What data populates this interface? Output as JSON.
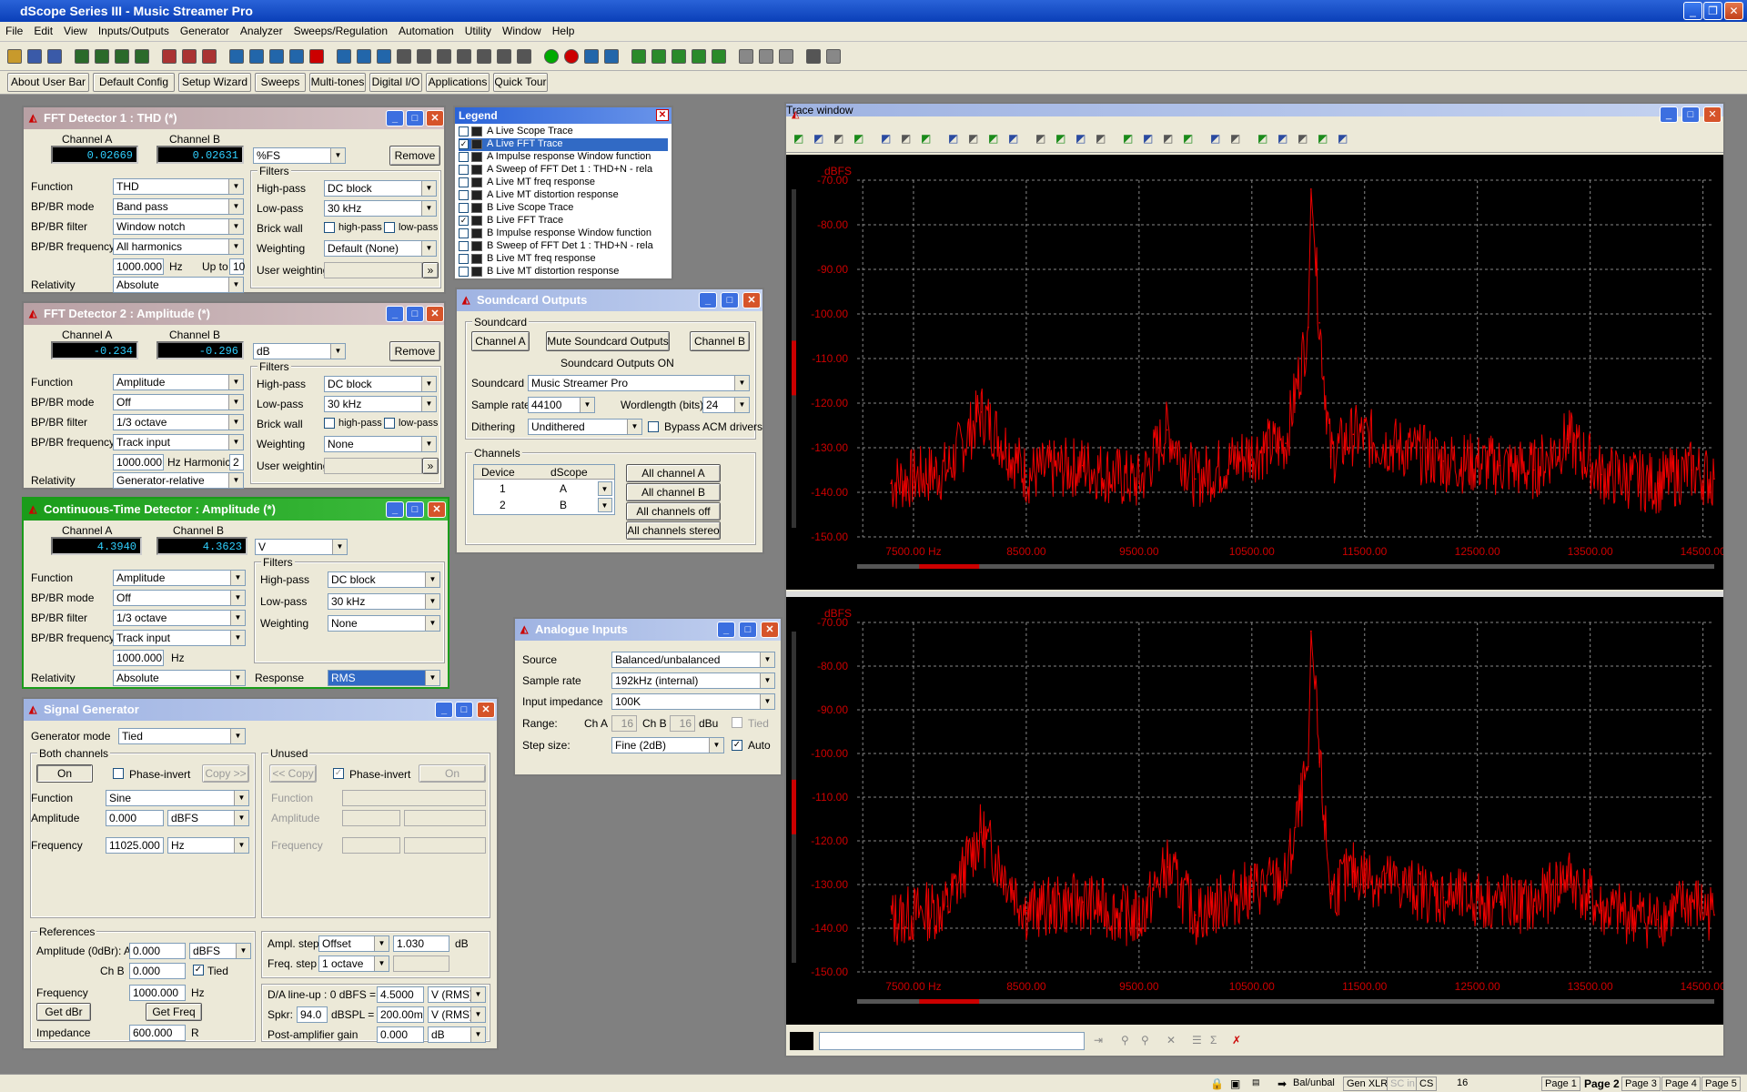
{
  "app": {
    "title": "dScope Series III - Music Streamer Pro"
  },
  "menu": [
    "File",
    "Edit",
    "View",
    "Inputs/Outputs",
    "Generator",
    "Analyzer",
    "Sweeps/Regulation",
    "Automation",
    "Utility",
    "Window",
    "Help"
  ],
  "userbar": [
    "About User Bar",
    "Default Config",
    "Setup Wizard",
    "Sweeps",
    "Multi-tones",
    "Digital I/O",
    "Applications",
    "Quick Tour"
  ],
  "fft1": {
    "title": "FFT Detector 1 : THD (*)",
    "cha_label": "Channel A",
    "chb_label": "Channel B",
    "cha_value": "0.02669",
    "chb_value": "0.02631",
    "unit": "%FS",
    "remove": "Remove",
    "function_label": "Function",
    "function": "THD",
    "bpbr_mode_label": "BP/BR mode",
    "bpbr_mode": "Band pass",
    "bpbr_filter_label": "BP/BR filter",
    "bpbr_filter": "Window notch",
    "bpbr_freq_label": "BP/BR frequency",
    "bpbr_freq": "All harmonics",
    "freq_value": "1000.000",
    "hz": "Hz",
    "upto_label": "Up to",
    "upto": "10",
    "relativity_label": "Relativity",
    "relativity": "Absolute",
    "filters_label": "Filters",
    "highpass_label": "High-pass",
    "highpass": "DC block",
    "lowpass_label": "Low-pass",
    "lowpass": "30 kHz",
    "brickwall_label": "Brick wall",
    "bw_hp": "high-pass",
    "bw_lp": "low-pass",
    "weighting_label": "Weighting",
    "weighting": "Default (None)",
    "userweight_label": "User weighting"
  },
  "fft2": {
    "title": "FFT Detector 2 : Amplitude (*)",
    "cha_label": "Channel A",
    "chb_label": "Channel B",
    "cha_value": "-0.234",
    "chb_value": "-0.296",
    "unit": "dB",
    "remove": "Remove",
    "function_label": "Function",
    "function": "Amplitude",
    "bpbr_mode_label": "BP/BR mode",
    "bpbr_mode": "Off",
    "bpbr_filter_label": "BP/BR filter",
    "bpbr_filter": "1/3 octave",
    "bpbr_freq_label": "BP/BR frequency",
    "bpbr_freq": "Track input",
    "freq_value": "1000.000",
    "hz": "Hz",
    "harmonic_label": "Harmonic",
    "harmonic": "2",
    "relativity_label": "Relativity",
    "relativity": "Generator-relative",
    "filters_label": "Filters",
    "highpass_label": "High-pass",
    "highpass": "DC block",
    "lowpass_label": "Low-pass",
    "lowpass": "30 kHz",
    "brickwall_label": "Brick wall",
    "bw_hp": "high-pass",
    "bw_lp": "low-pass",
    "weighting_label": "Weighting",
    "weighting": "None",
    "userweight_label": "User weighting"
  },
  "ctd": {
    "title": "Continuous-Time Detector : Amplitude (*)",
    "cha_label": "Channel A",
    "chb_label": "Channel B",
    "cha_value": "4.3940",
    "chb_value": "4.3623",
    "unit": "V",
    "function_label": "Function",
    "function": "Amplitude",
    "bpbr_mode_label": "BP/BR mode",
    "bpbr_mode": "Off",
    "bpbr_filter_label": "BP/BR filter",
    "bpbr_filter": "1/3 octave",
    "bpbr_freq_label": "BP/BR frequency",
    "bpbr_freq": "Track input",
    "freq_value": "1000.000",
    "hz": "Hz",
    "relativity_label": "Relativity",
    "relativity": "Absolute",
    "filters_label": "Filters",
    "highpass_label": "High-pass",
    "highpass": "DC block",
    "lowpass_label": "Low-pass",
    "lowpass": "30 kHz",
    "weighting_label": "Weighting",
    "weighting": "None",
    "response_label": "Response",
    "response": "RMS"
  },
  "siggen": {
    "title": "Signal Generator",
    "mode_label": "Generator mode",
    "mode": "Tied",
    "both_label": "Both channels",
    "on": "On",
    "phase_invert": "Phase-invert",
    "copy_right": "Copy >>",
    "unused_label": "Unused",
    "copy_left": "<< Copy",
    "on2": "On",
    "function_label": "Function",
    "function": "Sine",
    "amplitude_label": "Amplitude",
    "amplitude": "0.000",
    "amp_unit": "dBFS",
    "frequency_label": "Frequency",
    "frequency": "11025.000",
    "freq_unit": "Hz",
    "refs_label": "References",
    "ref_amp_label": "Amplitude (0dBr): A",
    "ref_amp_a": "0.000",
    "ref_amp_unit": "dBFS",
    "chb_label": "Ch B",
    "ref_amp_b": "0.000",
    "tied": "Tied",
    "ref_freq_label": "Frequency",
    "ref_freq": "1000.000",
    "ref_freq_unit": "Hz",
    "get_dbr": "Get dBr",
    "get_freq": "Get Freq",
    "impedance_label": "Impedance",
    "impedance": "600.000",
    "imp_unit": "R",
    "ampl_step_label": "Ampl. step",
    "ampl_step": "Offset",
    "ampl_step_val": "1.030",
    "db": "dB",
    "freq_step_label": "Freq. step",
    "freq_step": "1 octave",
    "da_label": "D/A line-up : 0 dBFS =",
    "da_value": "4.5000",
    "da_unit": "V (RMS)",
    "spkr_label": "Spkr:",
    "spkr_value": "94.0",
    "dbspl_label": "dBSPL =",
    "dbspl_value": "200.00m",
    "dbspl_unit": "V (RMS)",
    "post_label": "Post-amplifier gain",
    "post_value": "0.000",
    "post_unit": "dB"
  },
  "legend": {
    "title": "Legend",
    "items": [
      {
        "label": "A  Live Scope Trace",
        "checked": false
      },
      {
        "label": "A  Live FFT Trace",
        "checked": true,
        "selected": true
      },
      {
        "label": "A  Impulse response Window function",
        "checked": false
      },
      {
        "label": "A  Sweep of FFT Det 1 : THD+N - rela",
        "checked": false
      },
      {
        "label": "A  Live MT freq response",
        "checked": false
      },
      {
        "label": "A  Live MT distortion response",
        "checked": false
      },
      {
        "label": "B  Live Scope Trace",
        "checked": false
      },
      {
        "label": "B  Live FFT Trace",
        "checked": true
      },
      {
        "label": "B  Impulse response Window function",
        "checked": false
      },
      {
        "label": "B  Sweep of FFT Det 1 : THD+N - rela",
        "checked": false
      },
      {
        "label": "B  Live MT freq response",
        "checked": false
      },
      {
        "label": "B  Live MT distortion response",
        "checked": false
      }
    ]
  },
  "soundcard": {
    "title": "Soundcard Outputs",
    "group_label": "Soundcard",
    "cha": "Channel A",
    "mute": "Mute Soundcard Outputs",
    "chb": "Channel B",
    "status": "Soundcard Outputs ON",
    "soundcard_label": "Soundcard",
    "soundcard": "Music Streamer Pro",
    "samplerate_label": "Sample rate",
    "samplerate": "44100",
    "wordlength_label": "Wordlength (bits)",
    "wordlength": "24",
    "dither_label": "Dithering",
    "dither": "Undithered",
    "bypass": "Bypass ACM drivers",
    "channels_label": "Channels",
    "col_device": "Device",
    "col_dscope": "dScope",
    "rows": [
      {
        "device": "1",
        "dscope": "A"
      },
      {
        "device": "2",
        "dscope": "B"
      }
    ],
    "all_a": "All channel A",
    "all_b": "All channel B",
    "all_off": "All channels off",
    "all_stereo": "All channels stereo"
  },
  "analogue": {
    "title": "Analogue Inputs",
    "source_label": "Source",
    "source": "Balanced/unbalanced",
    "samplerate_label": "Sample rate",
    "samplerate": "192kHz (internal)",
    "impedance_label": "Input impedance",
    "impedance": "100K",
    "range_label": "Range:",
    "cha_label": "Ch A",
    "cha": "16",
    "chb_label": "Ch B",
    "chb": "16",
    "unit": "dBu",
    "tied": "Tied",
    "step_label": "Step size:",
    "step": "Fine (2dB)",
    "auto": "Auto"
  },
  "trace": {
    "title": "Trace window",
    "ylabel": "dBFS",
    "yticks": [
      "-70.00",
      "-80.00",
      "-90.00",
      "-100.00",
      "-110.00",
      "-120.00",
      "-130.00",
      "-140.00",
      "-150.00"
    ],
    "xticks": [
      "7500.00 Hz",
      "8500.00",
      "9500.00",
      "10500.00",
      "11500.00",
      "12500.00",
      "13500.00",
      "14500.00"
    ]
  },
  "status": [
    "Bal/unbal",
    "Gen XLR",
    "SC in",
    "CS",
    "16",
    "Page 1",
    "Page 2",
    "Page 3",
    "Page 4",
    "Page 5"
  ],
  "chart_data": [
    {
      "type": "line",
      "ylabel": "dBFS",
      "xlim": [
        7000,
        14600
      ],
      "ylim": [
        -150,
        -70
      ],
      "series": [
        {
          "x": [
            7300,
            7800,
            8100,
            8500,
            9000,
            9500,
            9750,
            10000,
            10500,
            10800,
            11000,
            11025,
            11100,
            11200,
            11400,
            11800,
            12200,
            12700,
            13000,
            13300,
            13600,
            14100,
            14400,
            14600
          ],
          "y": [
            -138,
            -135,
            -122,
            -136,
            -134,
            -138,
            -126,
            -137,
            -131,
            -129,
            -103,
            -72,
            -102,
            -132,
            -127,
            -130,
            -133,
            -134,
            -135,
            -128,
            -136,
            -138,
            -135,
            -137
          ]
        }
      ]
    },
    {
      "type": "line",
      "ylabel": "dBFS",
      "xlim": [
        7000,
        14600
      ],
      "ylim": [
        -150,
        -70
      ],
      "series": [
        {
          "x": [
            7300,
            7800,
            8100,
            8500,
            9000,
            9500,
            9750,
            10000,
            10500,
            10800,
            11000,
            11025,
            11100,
            11200,
            11400,
            11800,
            12200,
            12700,
            13000,
            13300,
            13600,
            14100,
            14400,
            14600
          ],
          "y": [
            -138,
            -135,
            -118,
            -136,
            -134,
            -138,
            -126,
            -137,
            -131,
            -129,
            -103,
            -72,
            -102,
            -132,
            -127,
            -130,
            -133,
            -134,
            -135,
            -128,
            -136,
            -138,
            -134,
            -137
          ]
        }
      ]
    }
  ]
}
